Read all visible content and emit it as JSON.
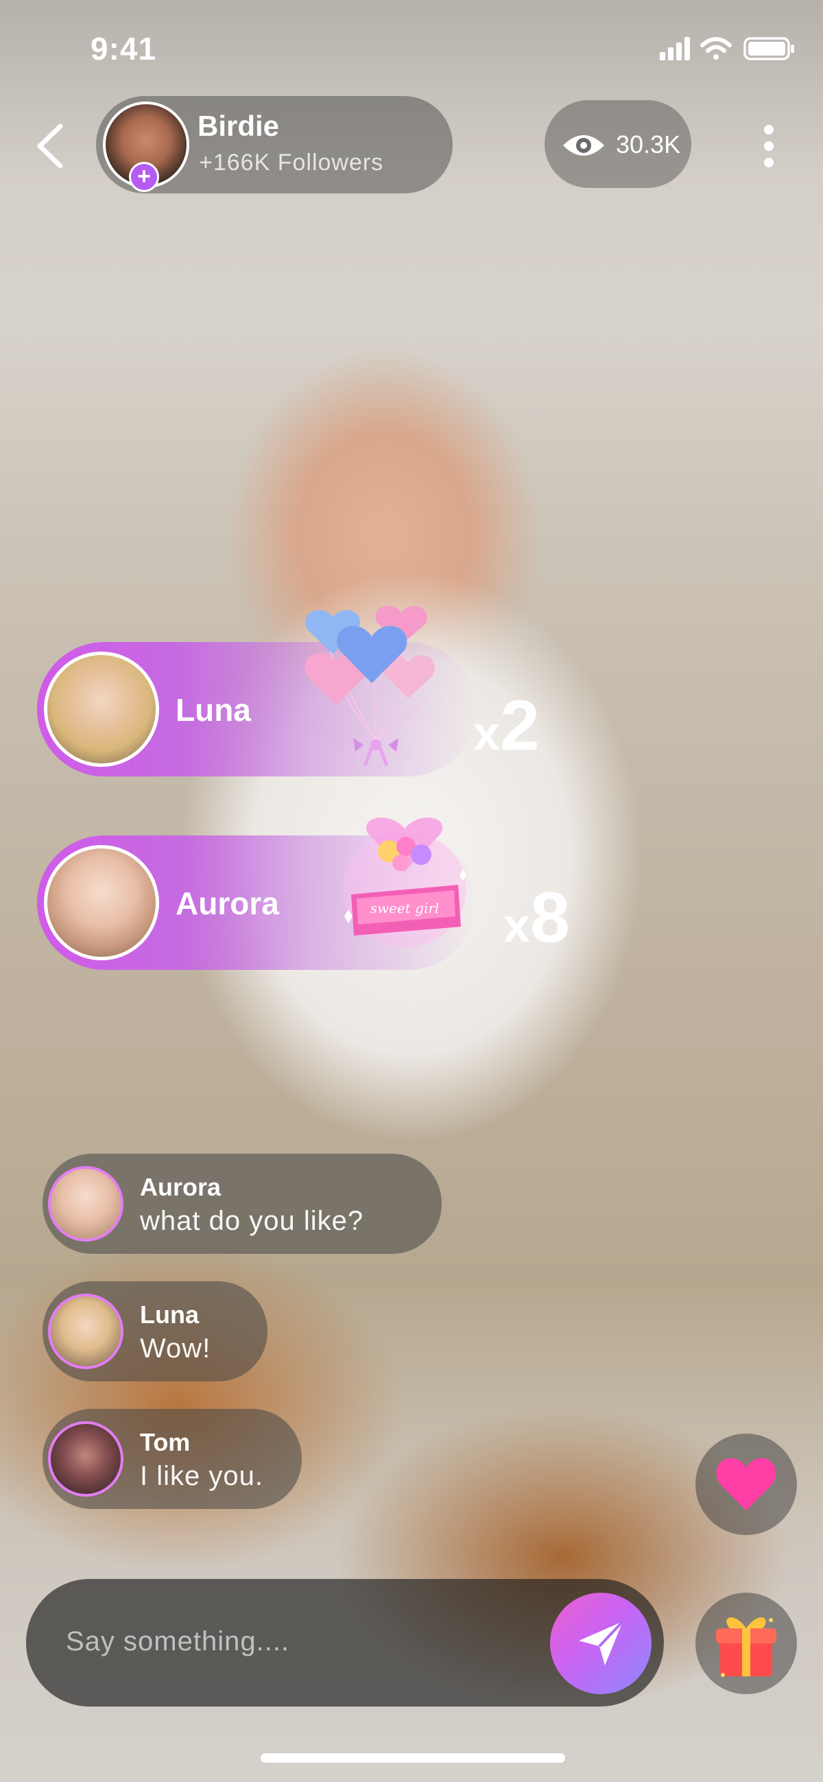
{
  "status_bar": {
    "time": "9:41"
  },
  "header": {
    "host_name": "Birdie",
    "host_followers": "+166K Followers",
    "follow_icon": "plus",
    "viewer_count": "30.3K"
  },
  "gift_feed": [
    {
      "user": "Luna",
      "count_prefix": "x",
      "count": "2",
      "gift_icon": "heart-balloons-icon"
    },
    {
      "user": "Aurora",
      "count_prefix": "x",
      "count": "8",
      "gift_icon": "sweet-girl-gift-box-icon",
      "gift_label": "sweet girl"
    }
  ],
  "chat": [
    {
      "user": "Aurora",
      "message": "what do  you  like?"
    },
    {
      "user": "Luna",
      "message": "Wow!"
    },
    {
      "user": "Tom",
      "message": "I like you."
    }
  ],
  "composer": {
    "placeholder": "Say something...."
  },
  "colors": {
    "accent_purple": "#c865f4",
    "accent_pink": "#ee5fd0",
    "heart": "#ff3fa6",
    "avatar_ring": "#e37df2"
  }
}
